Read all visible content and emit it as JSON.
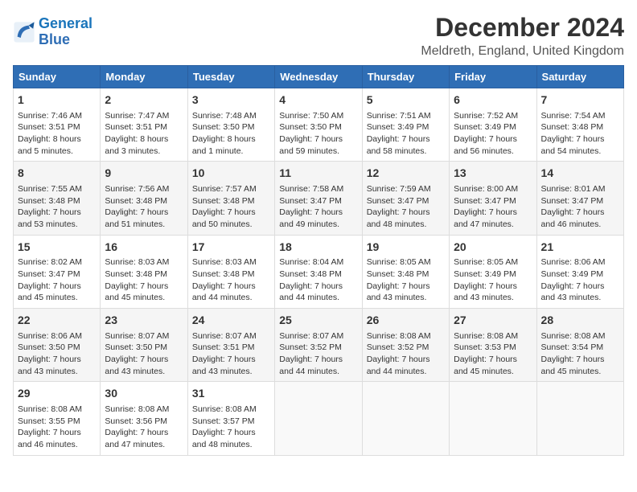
{
  "header": {
    "logo_line1": "General",
    "logo_line2": "Blue",
    "month_title": "December 2024",
    "location": "Meldreth, England, United Kingdom"
  },
  "weekdays": [
    "Sunday",
    "Monday",
    "Tuesday",
    "Wednesday",
    "Thursday",
    "Friday",
    "Saturday"
  ],
  "weeks": [
    [
      {
        "day": "1",
        "sunrise": "Sunrise: 7:46 AM",
        "sunset": "Sunset: 3:51 PM",
        "daylight": "Daylight: 8 hours and 5 minutes."
      },
      {
        "day": "2",
        "sunrise": "Sunrise: 7:47 AM",
        "sunset": "Sunset: 3:51 PM",
        "daylight": "Daylight: 8 hours and 3 minutes."
      },
      {
        "day": "3",
        "sunrise": "Sunrise: 7:48 AM",
        "sunset": "Sunset: 3:50 PM",
        "daylight": "Daylight: 8 hours and 1 minute."
      },
      {
        "day": "4",
        "sunrise": "Sunrise: 7:50 AM",
        "sunset": "Sunset: 3:50 PM",
        "daylight": "Daylight: 7 hours and 59 minutes."
      },
      {
        "day": "5",
        "sunrise": "Sunrise: 7:51 AM",
        "sunset": "Sunset: 3:49 PM",
        "daylight": "Daylight: 7 hours and 58 minutes."
      },
      {
        "day": "6",
        "sunrise": "Sunrise: 7:52 AM",
        "sunset": "Sunset: 3:49 PM",
        "daylight": "Daylight: 7 hours and 56 minutes."
      },
      {
        "day": "7",
        "sunrise": "Sunrise: 7:54 AM",
        "sunset": "Sunset: 3:48 PM",
        "daylight": "Daylight: 7 hours and 54 minutes."
      }
    ],
    [
      {
        "day": "8",
        "sunrise": "Sunrise: 7:55 AM",
        "sunset": "Sunset: 3:48 PM",
        "daylight": "Daylight: 7 hours and 53 minutes."
      },
      {
        "day": "9",
        "sunrise": "Sunrise: 7:56 AM",
        "sunset": "Sunset: 3:48 PM",
        "daylight": "Daylight: 7 hours and 51 minutes."
      },
      {
        "day": "10",
        "sunrise": "Sunrise: 7:57 AM",
        "sunset": "Sunset: 3:48 PM",
        "daylight": "Daylight: 7 hours and 50 minutes."
      },
      {
        "day": "11",
        "sunrise": "Sunrise: 7:58 AM",
        "sunset": "Sunset: 3:47 PM",
        "daylight": "Daylight: 7 hours and 49 minutes."
      },
      {
        "day": "12",
        "sunrise": "Sunrise: 7:59 AM",
        "sunset": "Sunset: 3:47 PM",
        "daylight": "Daylight: 7 hours and 48 minutes."
      },
      {
        "day": "13",
        "sunrise": "Sunrise: 8:00 AM",
        "sunset": "Sunset: 3:47 PM",
        "daylight": "Daylight: 7 hours and 47 minutes."
      },
      {
        "day": "14",
        "sunrise": "Sunrise: 8:01 AM",
        "sunset": "Sunset: 3:47 PM",
        "daylight": "Daylight: 7 hours and 46 minutes."
      }
    ],
    [
      {
        "day": "15",
        "sunrise": "Sunrise: 8:02 AM",
        "sunset": "Sunset: 3:47 PM",
        "daylight": "Daylight: 7 hours and 45 minutes."
      },
      {
        "day": "16",
        "sunrise": "Sunrise: 8:03 AM",
        "sunset": "Sunset: 3:48 PM",
        "daylight": "Daylight: 7 hours and 45 minutes."
      },
      {
        "day": "17",
        "sunrise": "Sunrise: 8:03 AM",
        "sunset": "Sunset: 3:48 PM",
        "daylight": "Daylight: 7 hours and 44 minutes."
      },
      {
        "day": "18",
        "sunrise": "Sunrise: 8:04 AM",
        "sunset": "Sunset: 3:48 PM",
        "daylight": "Daylight: 7 hours and 44 minutes."
      },
      {
        "day": "19",
        "sunrise": "Sunrise: 8:05 AM",
        "sunset": "Sunset: 3:48 PM",
        "daylight": "Daylight: 7 hours and 43 minutes."
      },
      {
        "day": "20",
        "sunrise": "Sunrise: 8:05 AM",
        "sunset": "Sunset: 3:49 PM",
        "daylight": "Daylight: 7 hours and 43 minutes."
      },
      {
        "day": "21",
        "sunrise": "Sunrise: 8:06 AM",
        "sunset": "Sunset: 3:49 PM",
        "daylight": "Daylight: 7 hours and 43 minutes."
      }
    ],
    [
      {
        "day": "22",
        "sunrise": "Sunrise: 8:06 AM",
        "sunset": "Sunset: 3:50 PM",
        "daylight": "Daylight: 7 hours and 43 minutes."
      },
      {
        "day": "23",
        "sunrise": "Sunrise: 8:07 AM",
        "sunset": "Sunset: 3:50 PM",
        "daylight": "Daylight: 7 hours and 43 minutes."
      },
      {
        "day": "24",
        "sunrise": "Sunrise: 8:07 AM",
        "sunset": "Sunset: 3:51 PM",
        "daylight": "Daylight: 7 hours and 43 minutes."
      },
      {
        "day": "25",
        "sunrise": "Sunrise: 8:07 AM",
        "sunset": "Sunset: 3:52 PM",
        "daylight": "Daylight: 7 hours and 44 minutes."
      },
      {
        "day": "26",
        "sunrise": "Sunrise: 8:08 AM",
        "sunset": "Sunset: 3:52 PM",
        "daylight": "Daylight: 7 hours and 44 minutes."
      },
      {
        "day": "27",
        "sunrise": "Sunrise: 8:08 AM",
        "sunset": "Sunset: 3:53 PM",
        "daylight": "Daylight: 7 hours and 45 minutes."
      },
      {
        "day": "28",
        "sunrise": "Sunrise: 8:08 AM",
        "sunset": "Sunset: 3:54 PM",
        "daylight": "Daylight: 7 hours and 45 minutes."
      }
    ],
    [
      {
        "day": "29",
        "sunrise": "Sunrise: 8:08 AM",
        "sunset": "Sunset: 3:55 PM",
        "daylight": "Daylight: 7 hours and 46 minutes."
      },
      {
        "day": "30",
        "sunrise": "Sunrise: 8:08 AM",
        "sunset": "Sunset: 3:56 PM",
        "daylight": "Daylight: 7 hours and 47 minutes."
      },
      {
        "day": "31",
        "sunrise": "Sunrise: 8:08 AM",
        "sunset": "Sunset: 3:57 PM",
        "daylight": "Daylight: 7 hours and 48 minutes."
      },
      null,
      null,
      null,
      null
    ]
  ]
}
